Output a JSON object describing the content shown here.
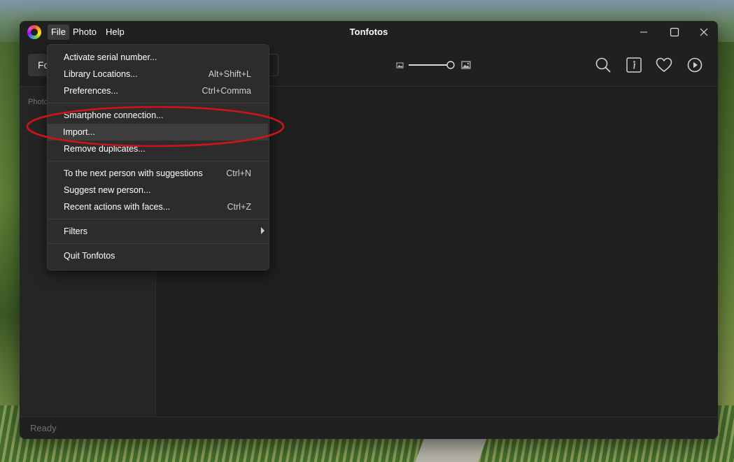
{
  "window": {
    "title": "Tonfotos",
    "menu": [
      "File",
      "Photo",
      "Help"
    ],
    "active_menu": "File"
  },
  "toolbar": {
    "button_label": "Fo"
  },
  "sidebar": {
    "section_label": "Photo"
  },
  "file_menu": {
    "groups": [
      [
        {
          "label": "Activate serial number...",
          "shortcut": ""
        },
        {
          "label": "Library Locations...",
          "shortcut": "Alt+Shift+L"
        },
        {
          "label": "Preferences...",
          "shortcut": "Ctrl+Comma"
        }
      ],
      [
        {
          "label": "Smartphone connection...",
          "shortcut": ""
        },
        {
          "label": "Import...",
          "shortcut": "",
          "highlighted": true
        },
        {
          "label": "Remove duplicates...",
          "shortcut": ""
        }
      ],
      [
        {
          "label": "To the next person with suggestions",
          "shortcut": "Ctrl+N"
        },
        {
          "label": "Suggest new person...",
          "shortcut": ""
        },
        {
          "label": "Recent actions with faces...",
          "shortcut": "Ctrl+Z"
        }
      ],
      [
        {
          "label": "Filters",
          "shortcut": "",
          "submenu": true
        }
      ],
      [
        {
          "label": "Quit Tonfotos",
          "shortcut": ""
        }
      ]
    ]
  },
  "statusbar": {
    "text": "Ready"
  },
  "icons": {
    "toolbar": [
      "small-image-icon",
      "large-image-icon",
      "search-icon",
      "info-icon",
      "heart-icon",
      "play-icon"
    ]
  },
  "colors": {
    "annotation": "#d0121b",
    "window_bg": "#1f1f1f",
    "menu_bg": "#2c2c2c"
  }
}
